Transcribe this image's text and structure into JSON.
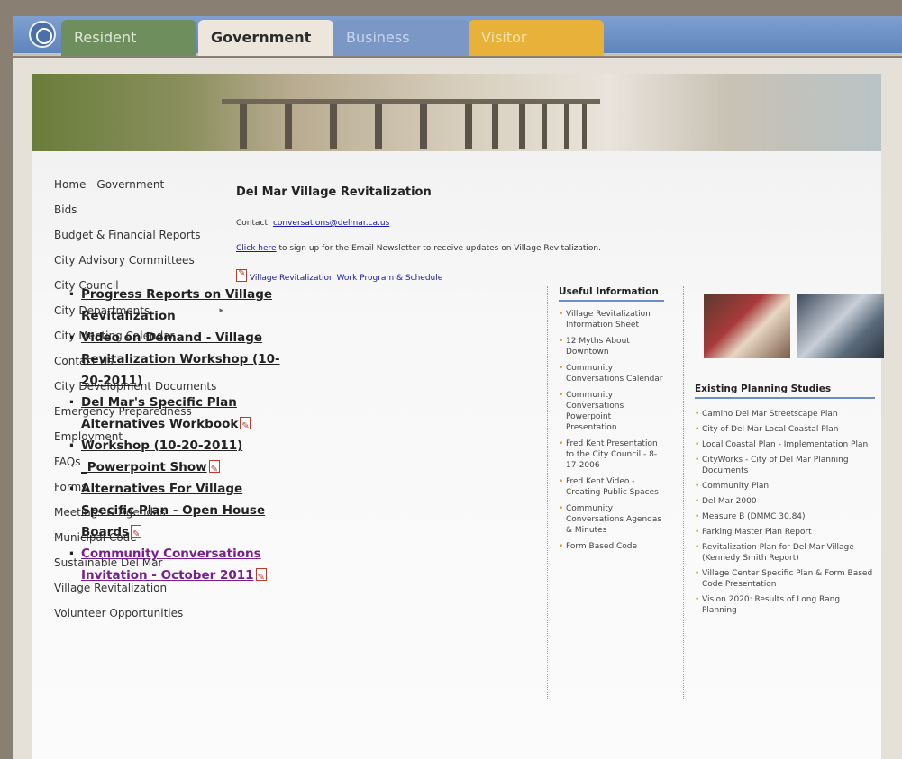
{
  "tabs": [
    {
      "label": "Resident"
    },
    {
      "label": "Government"
    },
    {
      "label": "Business"
    },
    {
      "label": "Visitor"
    }
  ],
  "nav": [
    "Home - Government",
    "Bids",
    "Budget & Financial Reports",
    "City Advisory Committees",
    "City Council",
    "City Departments",
    "City Meeting Calendar",
    "Contact Us",
    "City Development Documents",
    "Emergency Preparedness",
    "Employment",
    "FAQs",
    "Forms",
    "Meetings & Agendas",
    "Municipal Code",
    "Sustainable Del Mar",
    "Village Revitalization",
    "Volunteer Opportunities"
  ],
  "page": {
    "title": "Del Mar Village Revitalization",
    "contact_label": "Contact:",
    "contact_email": "conversations@delmar.ca.us",
    "click_here": "Click here",
    "signup_text": " to sign up for the Email Newsletter to receive updates on Village Revitalization.",
    "work_program_link": "Village Revitalization Work Program & Schedule"
  },
  "main_links": [
    "Progress Reports on Village Revitalization",
    "Video on Demand - Village Revitalization Workshop (10-20-2011)",
    "Del Mar's Specific Plan Alternatives Workbook",
    "Workshop (10-20-2011) _Powerpoint Show",
    "Alternatives For Village Specific Plan - Open House Boards",
    "Community Conversations Invitation - October 2011"
  ],
  "useful_info": {
    "heading": "Useful Information",
    "items": [
      "Village Revitalization Information Sheet",
      "12 Myths About Downtown",
      "Community Conversations Calendar",
      "Community Conversations Powerpoint Presentation",
      "Fred Kent Presentation to the City Council - 8-17-2006",
      "Fred Kent Video - Creating Public Spaces",
      "Community Conversations Agendas & Minutes",
      "Form Based Code"
    ]
  },
  "existing_studies": {
    "heading": "Existing Planning Studies",
    "items": [
      "Camino Del Mar Streetscape Plan",
      "City of Del Mar Local Coastal Plan",
      "Local Coastal Plan - Implementation Plan",
      "CityWorks - City of Del Mar Planning Documents",
      "Community Plan",
      "Del Mar 2000",
      "Measure B (DMMC 30.84)",
      "Parking Master Plan Report",
      "Revitalization Plan for Del Mar Village (Kennedy Smith Report)",
      "Village Center Specific Plan & Form Based Code Presentation",
      "Vision 2020: Results of Long Rang Planning"
    ]
  }
}
